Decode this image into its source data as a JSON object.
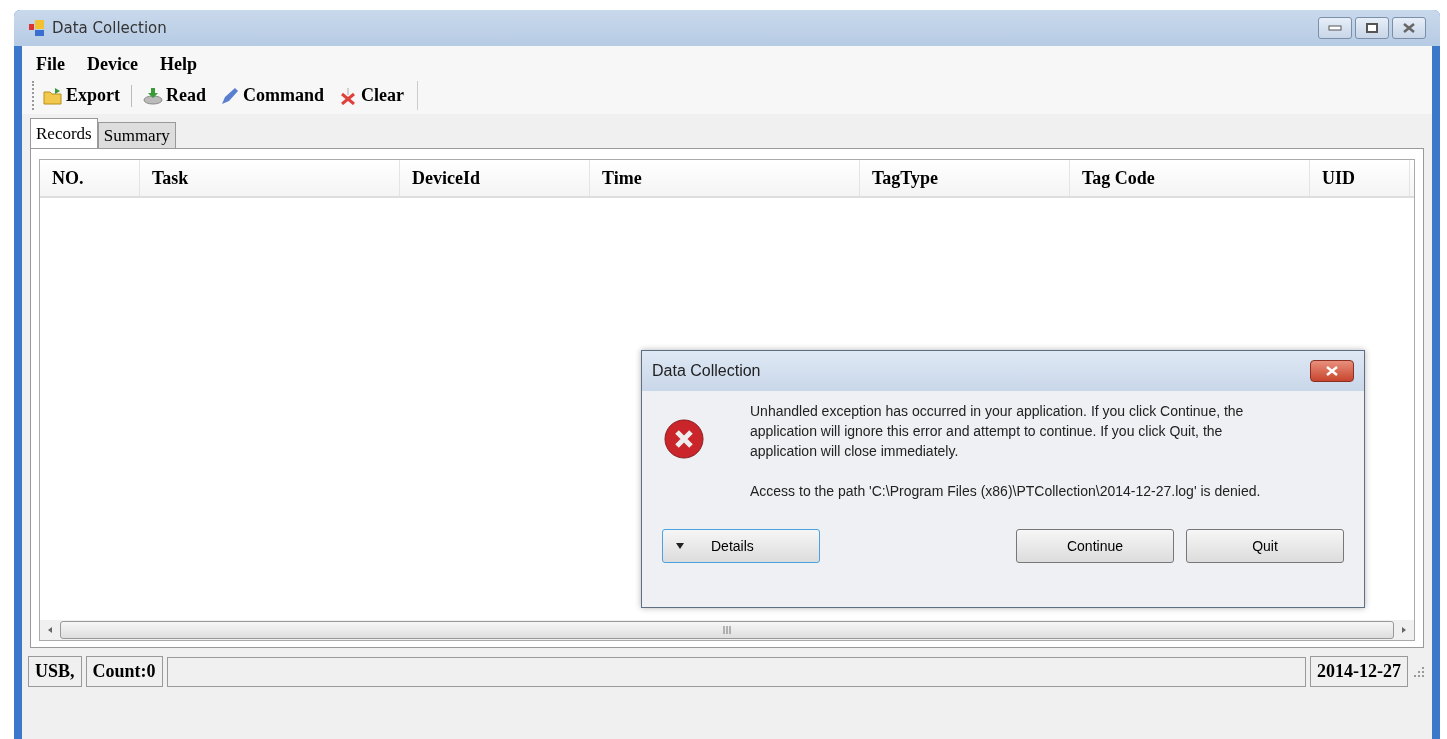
{
  "window": {
    "title": "Data Collection"
  },
  "menu": [
    "File",
    "Device",
    "Help"
  ],
  "toolbar": [
    {
      "kind": "export",
      "label": "Export"
    },
    {
      "kind": "read",
      "label": "Read"
    },
    {
      "kind": "command",
      "label": "Command"
    },
    {
      "kind": "clear",
      "label": "Clear"
    }
  ],
  "tabs": [
    {
      "label": "Records",
      "selected": true
    },
    {
      "label": "Summary",
      "selected": false
    }
  ],
  "table": {
    "columns": [
      "NO.",
      "Task",
      "DeviceId",
      "Time",
      "TagType",
      "Tag Code",
      "UID"
    ]
  },
  "status_bar": {
    "items": [
      "USB,",
      "Count:0"
    ],
    "date": "2014-12-27"
  },
  "dialog": {
    "title": "Data Collection",
    "message": "Unhandled exception has occurred in your application. If you click Continue, the application will ignore this error and attempt to continue. If you click Quit, the application will close immediately.",
    "detail": "Access to the path 'C:\\Program Files (x86)\\PTCollection\\2014-12-27.log' is denied.",
    "details_button": "Details",
    "buttons": [
      "Continue",
      "Quit"
    ]
  }
}
